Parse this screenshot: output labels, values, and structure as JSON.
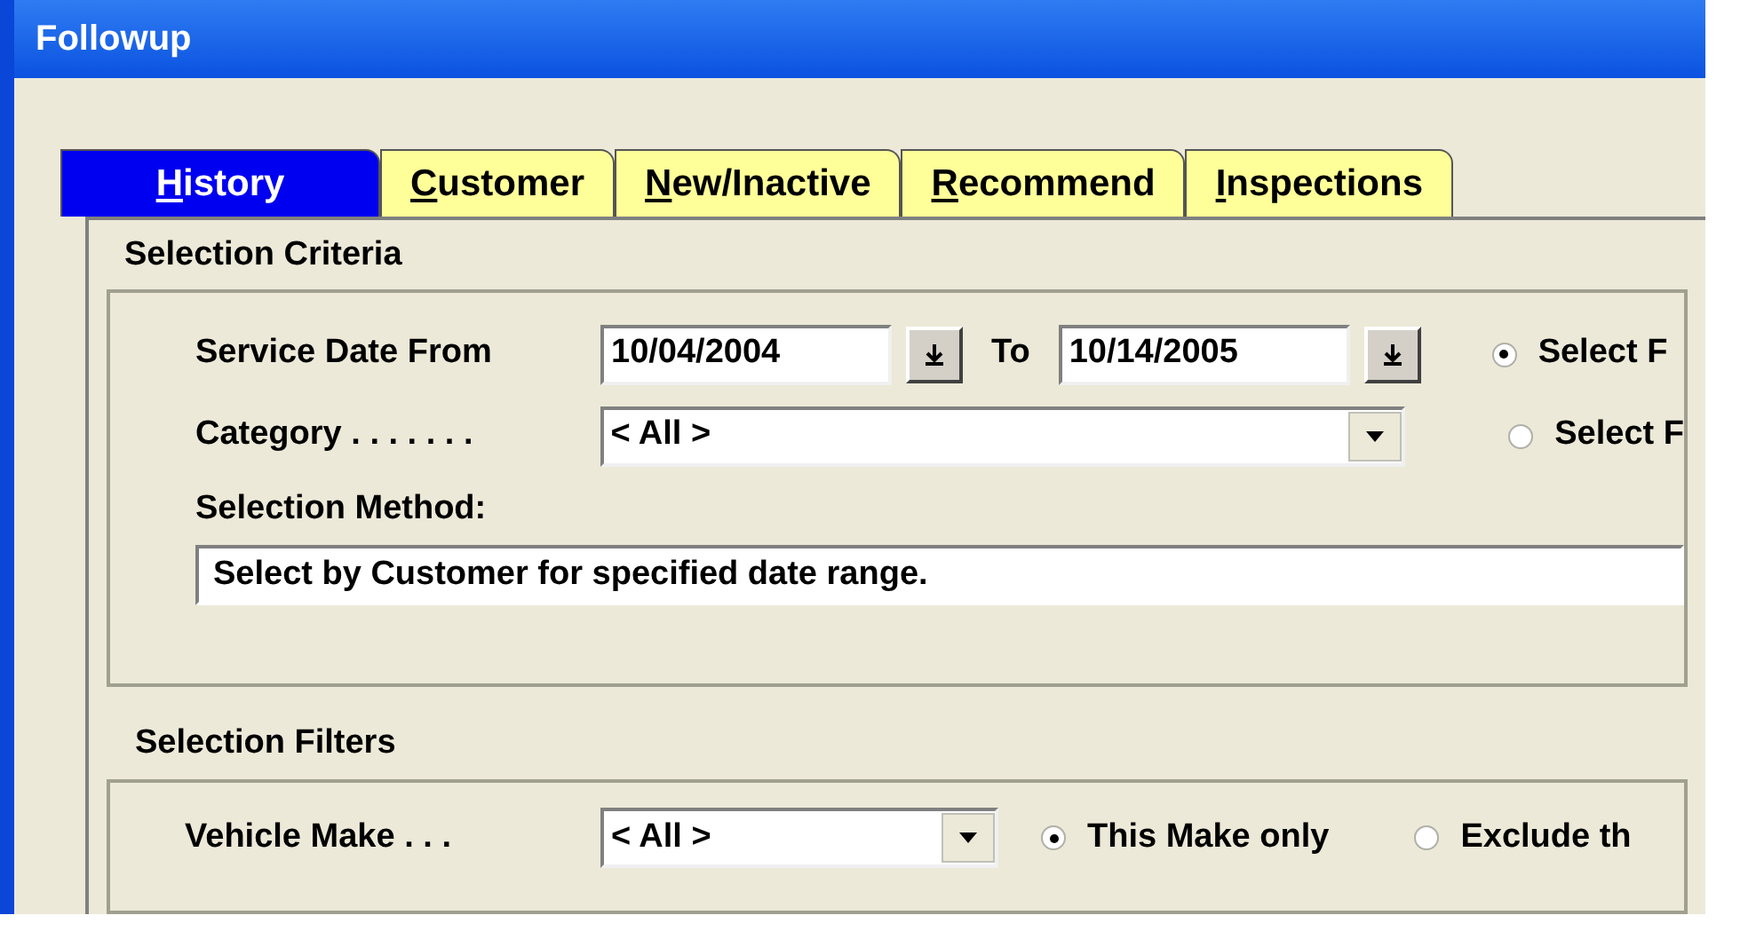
{
  "window": {
    "title": "Followup"
  },
  "tabs": [
    {
      "mnemonic": "H",
      "rest": "istory",
      "selected": true
    },
    {
      "mnemonic": "C",
      "rest": "ustomer",
      "selected": false
    },
    {
      "mnemonic": "N",
      "rest": "ew/Inactive",
      "selected": false
    },
    {
      "mnemonic": "R",
      "rest": "ecommend",
      "selected": false
    },
    {
      "mnemonic": "I",
      "rest": "nspections",
      "selected": false
    }
  ],
  "selection_criteria": {
    "title": "Selection Criteria",
    "service_date_label": "Service Date From",
    "date_from": "10/04/2004",
    "to_label": "To",
    "date_to": "10/14/2005",
    "category_label": "Category . . . . . . .",
    "category": "< All >",
    "radios": [
      {
        "label": "Select F",
        "selected": true
      },
      {
        "label": "Select F",
        "selected": false
      }
    ],
    "method_label": "Selection Method:",
    "method": "Select by Customer for specified date range."
  },
  "selection_filters": {
    "title": "Selection Filters",
    "vehicle_make_label": "Vehicle Make . . .",
    "vehicle_make": "< All >",
    "radios": [
      {
        "label": "This Make only",
        "selected": true
      },
      {
        "label": "Exclude th",
        "selected": false
      }
    ]
  }
}
